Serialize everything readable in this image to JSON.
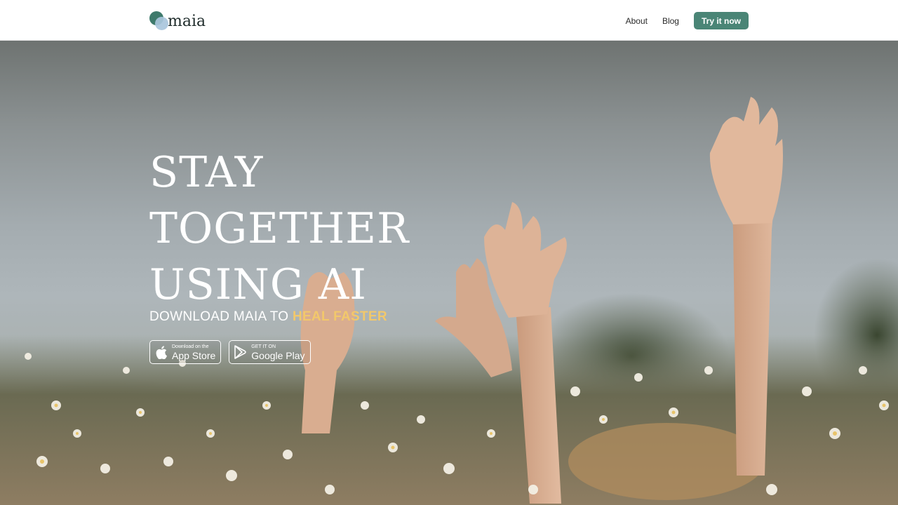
{
  "brand": {
    "name": "maia"
  },
  "nav": {
    "about": "About",
    "blog": "Blog",
    "cta": "Try it now"
  },
  "hero": {
    "headline": [
      "STAY",
      "TOGETHER",
      "USING AI"
    ],
    "subline_prefix": "DOWNLOAD MAIA TO ",
    "subline_accent": "HEAL FASTER"
  },
  "stores": {
    "apple": {
      "small": "Download on the",
      "big": "App Store",
      "icon": "apple-icon"
    },
    "google": {
      "small": "GET IT ON",
      "big": "Google Play",
      "icon": "google-play-icon"
    }
  },
  "colors": {
    "brand_green": "#4a8576",
    "accent_yellow": "#f2c86b",
    "header_bg": "#ffffff"
  }
}
